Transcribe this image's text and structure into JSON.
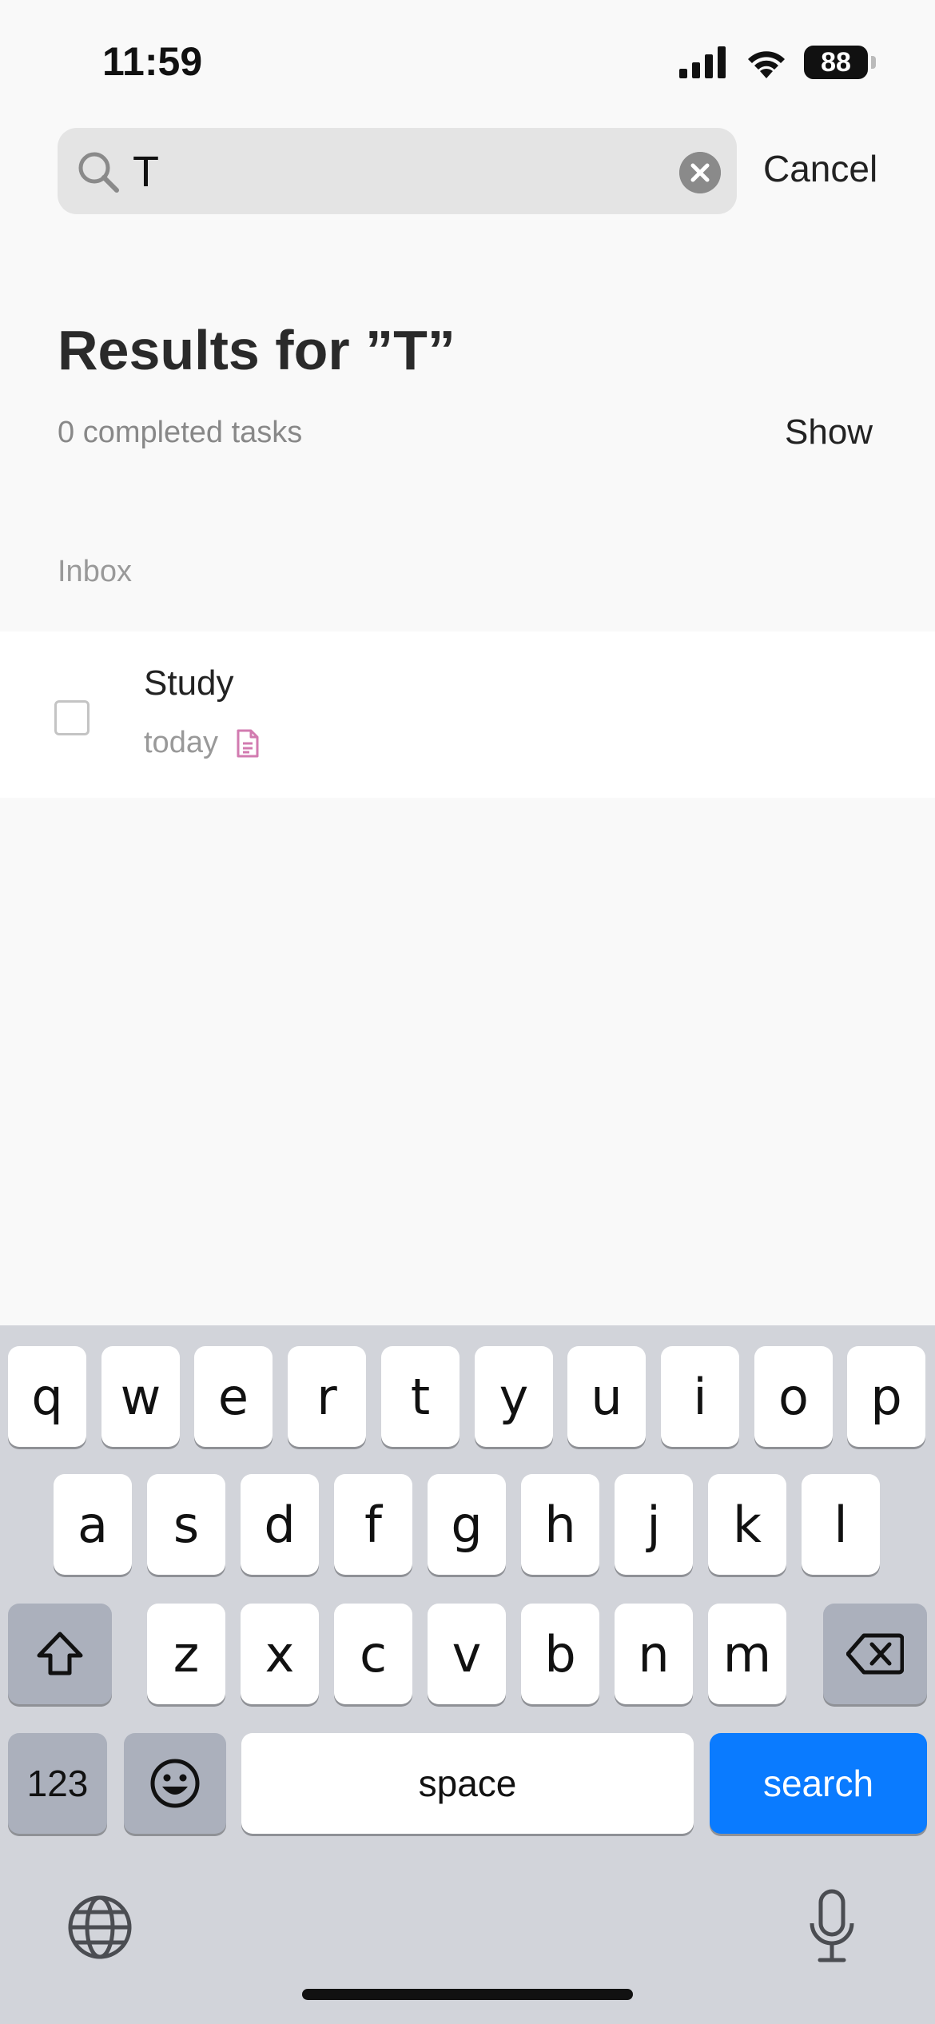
{
  "status_bar": {
    "time": "11:59",
    "battery": "88",
    "icons": [
      "cellular-signal-icon",
      "wifi-icon",
      "battery-icon"
    ]
  },
  "search": {
    "value": "T",
    "cancel_label": "Cancel"
  },
  "results": {
    "title": "Results for ”T”",
    "completed_text": "0 completed tasks",
    "show_label": "Show",
    "section_label": "Inbox",
    "tasks": [
      {
        "title": "Study",
        "due": "today",
        "icons": [
          "note-icon"
        ]
      }
    ]
  },
  "keyboard": {
    "row1": [
      "q",
      "w",
      "e",
      "r",
      "t",
      "y",
      "u",
      "i",
      "o",
      "p"
    ],
    "row2": [
      "a",
      "s",
      "d",
      "f",
      "g",
      "h",
      "j",
      "k",
      "l"
    ],
    "row3": [
      "z",
      "x",
      "c",
      "v",
      "b",
      "n",
      "m"
    ],
    "numbers_label": "123",
    "space_label": "space",
    "search_label": "search"
  },
  "colors": {
    "accent": "#0a7bff",
    "note_icon": "#d27bb0",
    "background": "#f9f9f9",
    "keyboard": "#d2d4da"
  }
}
